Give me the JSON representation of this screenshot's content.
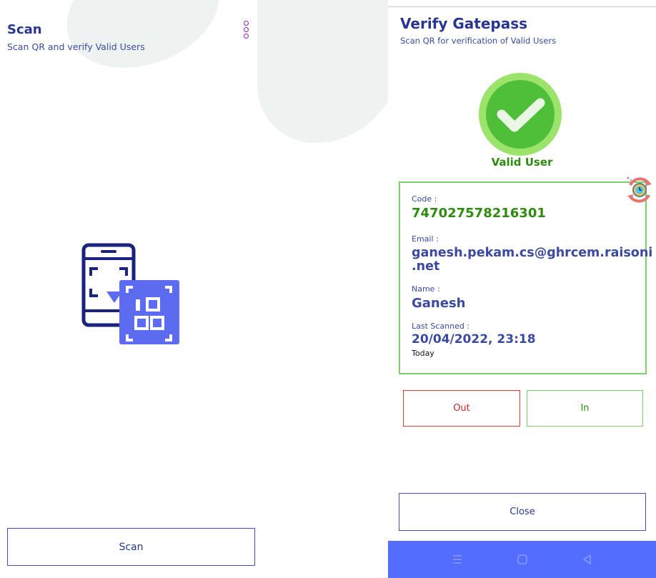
{
  "scan_screen": {
    "title": "Scan",
    "subtitle": "Scan QR and verify Valid Users",
    "menu_icon": "more-vertical-icon",
    "illustration_icon": "phone-qr-scan-icon",
    "scan_button_label": "Scan"
  },
  "verify_screen": {
    "title": "Verify Gatepass",
    "subtitle": "Scan QR for verification of Valid Users",
    "status_icon": "check-circle-icon",
    "status_label": "Valid User",
    "sync_icon": "sync-clock-icon",
    "fields": {
      "code_label": "Code :",
      "code_value": "747027578216301",
      "email_label": "Email :",
      "email_value_line1": "ganesh.pekam.cs@ghrcem.raisoni",
      "email_value_line2": ".net",
      "name_label": "Name :",
      "name_value": "Ganesh",
      "last_scanned_label": "Last Scanned :",
      "last_scanned_value": "20/04/2022, 23:18",
      "last_scanned_note": "Today"
    },
    "out_button_label": "Out",
    "in_button_label": "In",
    "close_button_label": "Close",
    "nav_icons": [
      "menu-icon",
      "home-icon",
      "back-icon"
    ]
  },
  "colors": {
    "primary": "#283593",
    "accent": "#536dfe",
    "success": "#2e8b0f",
    "danger": "#e53935",
    "menu": "#8e24aa"
  }
}
